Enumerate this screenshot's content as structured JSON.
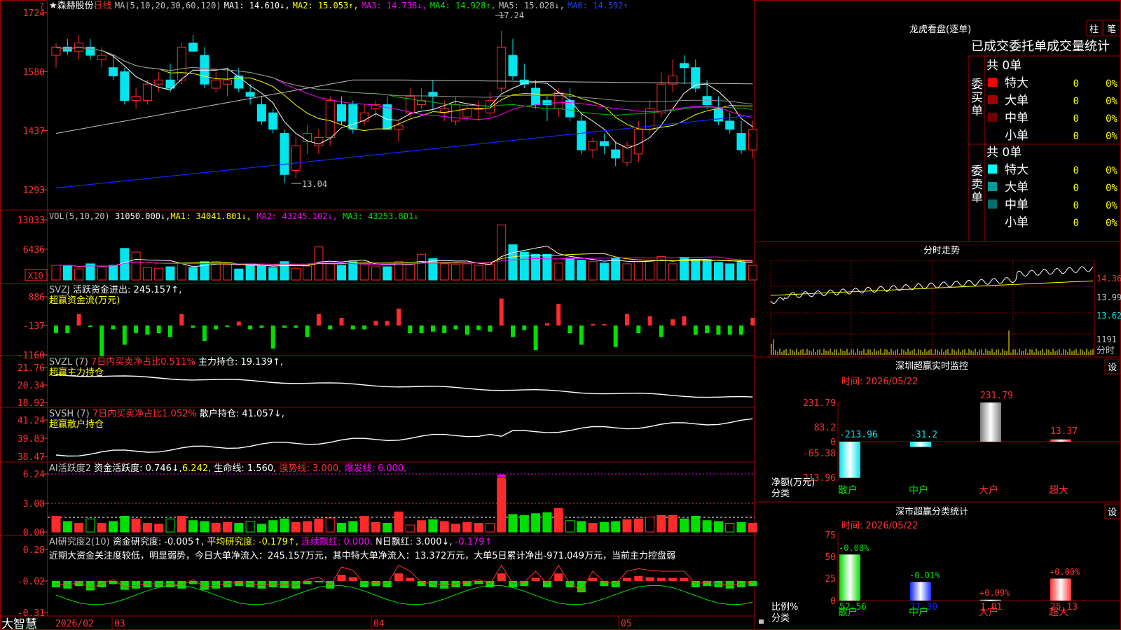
{
  "stock": {
    "star": "★",
    "name": "森赫股份",
    "period": "日线"
  },
  "bottom_bar": {
    "brand": "大智慧",
    "month1": "2026/02",
    "month2": "03",
    "month3": "04",
    "month4": "05"
  },
  "colors": {
    "up": "#ff2a2a",
    "down": "#00e5ee",
    "ma1": "#ffffff",
    "ma2": "#ffff00",
    "ma3": "#ff00ff",
    "ma4": "#00c000",
    "ma5": "#909090",
    "ma6": "#1428ff",
    "grid": "#9a0000",
    "axis_text": "#ff3030",
    "green_bar": "#00e000"
  },
  "kline": {
    "legend": {
      "prefix": "MA(5,10,20,30,60,120)",
      "ma1": "MA1: 14.610↓,",
      "ma2": "MA2: 15.053↑,",
      "ma3": "MA3: 14.738↓,",
      "ma4": "MA4: 14.928↑,",
      "ma5": "MA5: 15.028↓,",
      "ma6": "MA6: 14.592↑"
    },
    "y_ticks": [
      "1724",
      "1580",
      "1437",
      "1293"
    ],
    "y_values": [
      17.24,
      15.8,
      14.37,
      12.93
    ],
    "high_label": "17.24",
    "low_label": "13.04",
    "candles": [
      [
        16.2,
        16.5,
        15.9,
        16.4
      ],
      [
        16.4,
        16.6,
        16.2,
        16.3
      ],
      [
        16.3,
        16.7,
        16.1,
        16.5
      ],
      [
        16.4,
        16.6,
        16.1,
        16.2
      ],
      [
        16.1,
        16.4,
        15.9,
        16.2
      ],
      [
        15.9,
        16.2,
        15.6,
        15.7
      ],
      [
        15.8,
        15.9,
        15.0,
        15.1
      ],
      [
        15.1,
        15.4,
        14.9,
        15.2
      ],
      [
        15.1,
        15.6,
        15.0,
        15.5
      ],
      [
        15.5,
        15.8,
        15.3,
        15.6
      ],
      [
        15.6,
        16.0,
        15.3,
        15.4
      ],
      [
        15.6,
        16.5,
        15.5,
        16.4
      ],
      [
        16.5,
        16.7,
        16.3,
        16.3
      ],
      [
        16.2,
        16.4,
        15.4,
        15.5
      ],
      [
        15.4,
        15.8,
        15.3,
        15.6
      ],
      [
        15.5,
        15.9,
        15.2,
        15.6
      ],
      [
        15.7,
        15.9,
        15.3,
        15.4
      ],
      [
        15.3,
        15.5,
        15.0,
        15.2
      ],
      [
        15.0,
        15.2,
        14.5,
        14.6
      ],
      [
        14.8,
        14.9,
        14.3,
        14.4
      ],
      [
        14.3,
        14.4,
        13.1,
        13.3
      ],
      [
        13.4,
        14.2,
        13.2,
        14.0
      ],
      [
        14.1,
        14.5,
        13.8,
        14.3
      ],
      [
        14.0,
        14.4,
        13.8,
        14.2
      ],
      [
        14.2,
        15.2,
        14.0,
        15.1
      ],
      [
        15.0,
        15.2,
        14.5,
        14.6
      ],
      [
        15.0,
        15.1,
        14.3,
        14.4
      ],
      [
        14.6,
        15.0,
        14.5,
        14.8
      ],
      [
        14.9,
        15.1,
        14.7,
        15.0
      ],
      [
        15.0,
        15.2,
        14.4,
        14.4
      ],
      [
        14.4,
        14.6,
        14.1,
        14.5
      ],
      [
        14.8,
        15.4,
        14.7,
        15.2
      ],
      [
        15.0,
        15.4,
        14.9,
        15.1
      ],
      [
        15.3,
        15.6,
        14.9,
        15.2
      ],
      [
        14.8,
        15.1,
        14.6,
        14.9
      ],
      [
        14.6,
        15.2,
        14.5,
        15.0
      ],
      [
        14.7,
        15.0,
        14.6,
        14.9
      ],
      [
        14.9,
        15.1,
        14.6,
        14.9
      ],
      [
        14.8,
        15.3,
        14.7,
        15.1
      ],
      [
        15.4,
        16.8,
        15.3,
        16.4
      ],
      [
        16.2,
        16.6,
        15.6,
        15.7
      ],
      [
        15.6,
        16.0,
        15.4,
        15.5
      ],
      [
        15.4,
        15.6,
        14.9,
        15.0
      ],
      [
        15.1,
        15.2,
        14.6,
        15.0
      ],
      [
        14.9,
        15.4,
        14.7,
        15.3
      ],
      [
        15.1,
        15.4,
        14.6,
        14.7
      ],
      [
        14.6,
        14.8,
        13.8,
        13.9
      ],
      [
        13.9,
        14.2,
        13.7,
        14.1
      ],
      [
        14.1,
        14.3,
        13.8,
        14.0
      ],
      [
        13.9,
        14.1,
        13.5,
        13.7
      ],
      [
        13.6,
        14.1,
        13.5,
        14.0
      ],
      [
        13.8,
        14.6,
        13.6,
        14.4
      ],
      [
        14.4,
        15.1,
        14.3,
        14.9
      ],
      [
        14.8,
        15.8,
        14.7,
        15.5
      ],
      [
        15.5,
        16.1,
        15.3,
        15.7
      ],
      [
        16.0,
        16.2,
        15.5,
        15.9
      ],
      [
        15.9,
        16.1,
        15.3,
        15.4
      ],
      [
        15.2,
        15.6,
        14.9,
        15.0
      ],
      [
        14.9,
        15.2,
        14.5,
        14.6
      ],
      [
        14.6,
        14.8,
        14.3,
        14.4
      ],
      [
        14.3,
        14.6,
        13.8,
        13.9
      ],
      [
        13.9,
        14.6,
        13.7,
        14.4
      ]
    ]
  },
  "volume": {
    "legend": {
      "prefix": "VOL(5,10,20)",
      "value": "31050.000↓,",
      "ma1": "MA1: 34041.801↓,",
      "ma2": "MA2: 43245.102↓,",
      "ma3": "MA3: 43253.801↓"
    },
    "y_ticks": [
      "13033",
      "6436"
    ],
    "unit": "X10",
    "values": [
      2,
      2,
      1.5,
      2.2,
      1.8,
      2,
      4.3,
      3.8,
      1.7,
      1.6,
      1.8,
      2.3,
      1.7,
      2.5,
      2.5,
      2.1,
      1.5,
      2.2,
      1.9,
      1.7,
      2.5,
      1.6,
      1.9,
      4.5,
      2.3,
      2.0,
      2.5,
      2.2,
      1.8,
      1.8,
      2.5,
      2.2,
      3.5,
      2.9,
      2.2,
      2.1,
      2.2,
      2.0,
      2.1,
      7.5,
      4.8,
      3.8,
      3.5,
      3.5,
      2.3,
      3.0,
      2.7,
      2.5,
      2.3,
      3.0,
      2.2,
      2.5,
      2.7,
      3.2,
      2.2,
      3.1,
      2.8,
      2.7,
      2.4,
      2.2,
      2.4,
      2.0
    ]
  },
  "svzj": {
    "legend": {
      "prefix": "SVZJ",
      "label": "活跃资金进出: 245.157↑,",
      "sub": "超赢资金流(万元)"
    },
    "y_ticks": [
      "886",
      "-137",
      "-1160"
    ],
    "values": [
      -1,
      -1,
      1.5,
      -0.2,
      -4,
      -0.5,
      -2.5,
      -1,
      -1.2,
      -1,
      -1.5,
      1.5,
      -0.3,
      -2,
      -0.5,
      -0.2,
      0.5,
      -0.5,
      -0.3,
      -3,
      -0.3,
      -0.3,
      -1.5,
      1.5,
      -0.5,
      1,
      -0.5,
      -0.5,
      0.6,
      0.6,
      2.2,
      -1,
      -1,
      -0.8,
      -1,
      -0.5,
      -1.2,
      -0.6,
      -0.8,
      3.5,
      -1.5,
      -0.6,
      -3.2,
      0.3,
      2.8,
      -1,
      -2.5,
      0.2,
      0.2,
      -2.8,
      1.5,
      -1,
      1.2,
      -1.5,
      0.8,
      1.2,
      -1.2,
      -1,
      -1.2,
      -1.2,
      -1.2,
      1.0
    ]
  },
  "svzl": {
    "legend": {
      "prefix": "SVZL (7)",
      "ratio": "7日内买卖净占比0.511%",
      "label": "主力持仓: 19.139↑,",
      "sub": "超赢主力持仓"
    },
    "y_ticks": [
      "21.76",
      "20.34",
      "18.92"
    ]
  },
  "svsh": {
    "legend": {
      "prefix": "SVSH (7)",
      "ratio": "7日内买卖净占比1.052%",
      "label": "散户持仓: 41.057↓,",
      "sub": "超赢散户持仓"
    },
    "y_ticks": [
      "41.24",
      "39.83",
      "38.47"
    ]
  },
  "ai_active": {
    "legend": {
      "prefix": "AI活跃度2",
      "label": "资金活跃度: 0.746↓,",
      "v2": "6.242,",
      "life": "生命线: 1.560,",
      "strong": "强势线: 3.000,",
      "burst": "爆发线: 6.000,"
    },
    "y_ticks": [
      "6.24",
      "3.08",
      "0.00"
    ],
    "values": [
      1.8,
      1.2,
      1.0,
      1.5,
      1.0,
      1.2,
      1.8,
      1.5,
      1.0,
      0.9,
      1.5,
      1.8,
      1.3,
      1.2,
      1.0,
      1.1,
      1.0,
      1.2,
      0.9,
      1.3,
      1.5,
      1.1,
      1.2,
      1.5,
      1.6,
      1.0,
      1.2,
      1.8,
      1.1,
      1.0,
      2.3,
      0.8,
      1.3,
      1.4,
      1.2,
      0.9,
      1.1,
      1.0,
      1.0,
      6.2,
      2.0,
      1.9,
      2.1,
      2.2,
      2.7,
      1.3,
      1.2,
      1.0,
      1.1,
      1.2,
      1.4,
      1.5,
      1.7,
      1.9,
      1.9,
      1.5,
      1.8,
      1.3,
      1.2,
      1.0,
      1.1,
      1.0
    ]
  },
  "ai_research": {
    "legend": {
      "prefix": "AI研究度2(10)",
      "label": "资金研究度: -0.005↑,",
      "avg": "平均研究度: -0.179↑,",
      "streak": "连续飘红: 0.000,",
      "nday": "N日飘红: 3.000↓,",
      "v5": "-0.179↑"
    },
    "comment": "近期大资金关注度较低，明显弱势，今日大单净流入：245.157万元，其中特大单净流入：13.372万元，大单5日累计净出-971.049万元，当前主力控盘弱",
    "y_ticks": [
      "0.28",
      "-0.02",
      "-0.31"
    ],
    "values": [
      -0.1,
      -0.12,
      -0.08,
      -0.15,
      -0.1,
      -0.05,
      -0.14,
      -0.12,
      -0.1,
      -0.1,
      -0.1,
      -0.12,
      -0.05,
      -0.14,
      -0.12,
      -0.1,
      -0.08,
      -0.1,
      -0.12,
      -0.1,
      -0.11,
      -0.12,
      -0.05,
      -0.02,
      -0.12,
      0.1,
      0.06,
      -0.1,
      -0.08,
      -0.1,
      0.12,
      0.05,
      -0.08,
      -0.1,
      -0.12,
      -0.1,
      -0.08,
      -0.05,
      -0.1,
      0.12,
      -0.1,
      -0.08,
      0.05,
      -0.1,
      0.12,
      -0.1,
      -0.18,
      0.05,
      -0.08,
      -0.1,
      0.05,
      0.08,
      0.06,
      0.05,
      0.05,
      0.05,
      -0.1,
      -0.08,
      -0.1,
      -0.12,
      -0.1,
      -0.08
    ]
  },
  "dragon": {
    "title": "龙虎看盘(逐单)",
    "btn_bar": "柱",
    "btn_pen": "笔",
    "subtitle": "已成交委托单成交量统计",
    "buy_label": "委买单",
    "sell_label": "委卖单",
    "buy_total": "共 0单",
    "sell_total": "共 0单",
    "buy_rows": [
      {
        "label": "特大",
        "count": "0",
        "pct": "0%",
        "color": "#ff0000"
      },
      {
        "label": "大单",
        "count": "0",
        "pct": "0%",
        "color": "#a00000"
      },
      {
        "label": "中单",
        "count": "0",
        "pct": "0%",
        "color": "#700000"
      },
      {
        "label": "小单",
        "count": "0",
        "pct": "0%",
        "color": ""
      }
    ],
    "sell_rows": [
      {
        "label": "特大",
        "count": "0",
        "pct": "0%",
        "color": "#00ffff"
      },
      {
        "label": "大单",
        "count": "0",
        "pct": "0%",
        "color": "#009a9a"
      },
      {
        "label": "中单",
        "count": "0",
        "pct": "0%",
        "color": "#007070"
      },
      {
        "label": "小单",
        "count": "0",
        "pct": "0%",
        "color": ""
      }
    ]
  },
  "intraday": {
    "title": "分时走势",
    "y_ticks": [
      "14.36",
      "13.99",
      "13.62"
    ],
    "vol_tick": "1191",
    "vol_label": "分时"
  },
  "monitor": {
    "title": "深圳超赢实时监控",
    "set_btn": "设",
    "time": "时间: 2026/05/22",
    "y_ticks": [
      "231.79",
      "83.2",
      "0",
      "-65.38",
      "-213.96"
    ],
    "unit_label": "净额(万元)",
    "cat_label": "分类",
    "categories": [
      "散户",
      "中户",
      "大户",
      "超大"
    ],
    "values": [
      -213.96,
      -31.2,
      231.79,
      13.37
    ],
    "value_labels": [
      "-213.96",
      "-31.2",
      "231.79",
      "13.37"
    ]
  },
  "classify": {
    "title": "深市超赢分类统计",
    "set_btn": "设",
    "time": "时间: 2026/05/22",
    "y_ticks": [
      "75",
      "50",
      "25",
      "0"
    ],
    "unit_label": "比例%",
    "cat_label": "分类",
    "categories": [
      "散户",
      "中户",
      "大户",
      "超大"
    ],
    "values": [
      52.56,
      21.3,
      1.01,
      25.13
    ],
    "value_labels": [
      "52.56",
      "21.30",
      "1.01",
      "25.13"
    ],
    "change_labels": [
      "-0.08%",
      "-0.01%",
      "+0.09%",
      "+0.00%"
    ]
  }
}
